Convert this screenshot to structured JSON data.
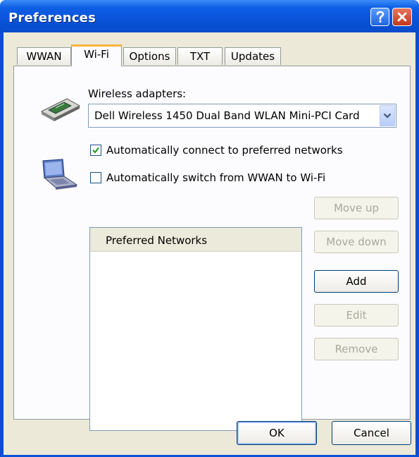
{
  "window": {
    "title": "Preferences",
    "help_icon": "question-mark-icon",
    "close_icon": "close-x-icon"
  },
  "tabs": [
    {
      "label": "WWAN",
      "active": false
    },
    {
      "label": "Wi-Fi",
      "active": true
    },
    {
      "label": "Options",
      "active": false
    },
    {
      "label": "TXT",
      "active": false
    },
    {
      "label": "Updates",
      "active": false
    }
  ],
  "wifi": {
    "adapters_label": "Wireless adapters:",
    "adapter_selected": "Dell Wireless 1450 Dual Band WLAN Mini-PCI Card",
    "adapter_icon": "wireless-card-icon",
    "laptop_icon": "laptop-icon",
    "auto_connect_label": "Automatically connect to preferred networks",
    "auto_connect_checked": true,
    "auto_switch_label": "Automatically switch from WWAN to Wi-Fi",
    "auto_switch_checked": false,
    "networks_header": "Preferred Networks",
    "networks": [],
    "buttons": {
      "move_up": "Move up",
      "move_down": "Move down",
      "add": "Add",
      "edit": "Edit",
      "remove": "Remove"
    }
  },
  "dialog_buttons": {
    "ok": "OK",
    "cancel": "Cancel"
  },
  "colors": {
    "titlebar": "#0a53d6",
    "face": "#ece9d8",
    "tab_highlight": "#f9b43f",
    "close_button": "#c1381c",
    "checkmark": "#21a121"
  }
}
